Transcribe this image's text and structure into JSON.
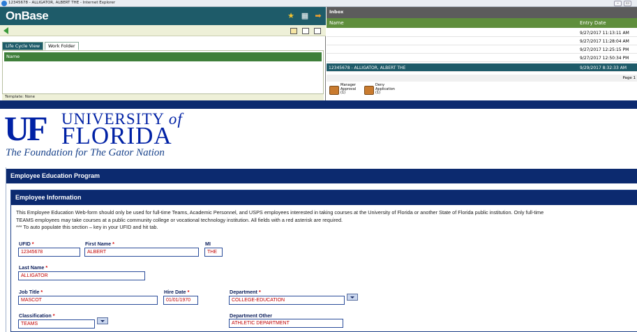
{
  "window": {
    "title": "12345678 - ALLIGATOR, ALBERT THE - Internet Explorer",
    "minimize": "–",
    "restore": "▭"
  },
  "onbase": {
    "logo": "OnBase",
    "tabs": [
      "Life Cycle View",
      "Work Folder"
    ],
    "folder_column": "Name",
    "template": "Template: None"
  },
  "inbox": {
    "title": "Inbox",
    "columns": {
      "name": "Name",
      "entry_date": "Entry Date"
    },
    "rows": [
      {
        "name": "",
        "date": "9/27/2017 11:13:11 AM"
      },
      {
        "name": "",
        "date": "9/27/2017 11:28:04 AM"
      },
      {
        "name": "",
        "date": "9/27/2017 12:25:15 PM"
      },
      {
        "name": "",
        "date": "9/27/2017 12:50:34 PM"
      },
      {
        "name": "12345678 - ALLIGATOR, ALBERT THE",
        "date": "9/29/2017 8:32:33 AM"
      }
    ],
    "page": "Page 1",
    "tasks": [
      {
        "line1": "Manager",
        "line2": "Approval",
        "line3": "(1)"
      },
      {
        "line1": "Deny",
        "line2": "Application",
        "line3": "(1)"
      }
    ]
  },
  "uf": {
    "mark": "UF",
    "university": "UNIVERSITY",
    "of": "of",
    "florida": "FLORIDA",
    "tagline": "The Foundation for The Gator Nation"
  },
  "form": {
    "program_title": "Employee Education Program",
    "section_title": "Employee Information",
    "desc_line1": "This Employee Education Web-form should only be used for full-time Teams, Academic Personnel, and USPS employees interested in taking courses at the University of Florida or another State of Florida public institution. Only full-time",
    "desc_line2": "TEAMS employees may take courses at a public community college or vocational technology institution. All fields with a red asterisk are required.",
    "desc_line3": "*** To auto populate this section – key in your UFID and hit tab.",
    "required_mark": "*",
    "fields": {
      "ufid": {
        "label": "UFID",
        "value": "12345678"
      },
      "first_name": {
        "label": "First Name",
        "value": "ALBERT"
      },
      "mi": {
        "label": "MI",
        "value": "THE"
      },
      "last_name": {
        "label": "Last Name",
        "value": "ALLIGATOR"
      },
      "job_title": {
        "label": "Job Title",
        "value": "MASCOT"
      },
      "hire_date": {
        "label": "Hire Date",
        "value": "01/01/1970"
      },
      "department": {
        "label": "Department",
        "value": "COLLEGE-EDUCATION"
      },
      "classification": {
        "label": "Classification",
        "value": "TEAMS"
      },
      "department_other": {
        "label": "Department Other",
        "value": "ATHLETIC DEPARTMENT"
      }
    }
  },
  "colors": {
    "onbase_teal": "#1e5b69",
    "uf_blue": "#0021a5",
    "form_navy": "#0c2a6f",
    "value_red": "#c00000",
    "header_green": "#5f8e3c"
  },
  "icons": [
    "ie-icon",
    "star-icon",
    "calculator-icon",
    "arrow-right-icon",
    "back-arrow-icon",
    "add-folder-icon",
    "split-view-icon",
    "window-icon",
    "task-icon",
    "dropdown-arrow-icon"
  ]
}
